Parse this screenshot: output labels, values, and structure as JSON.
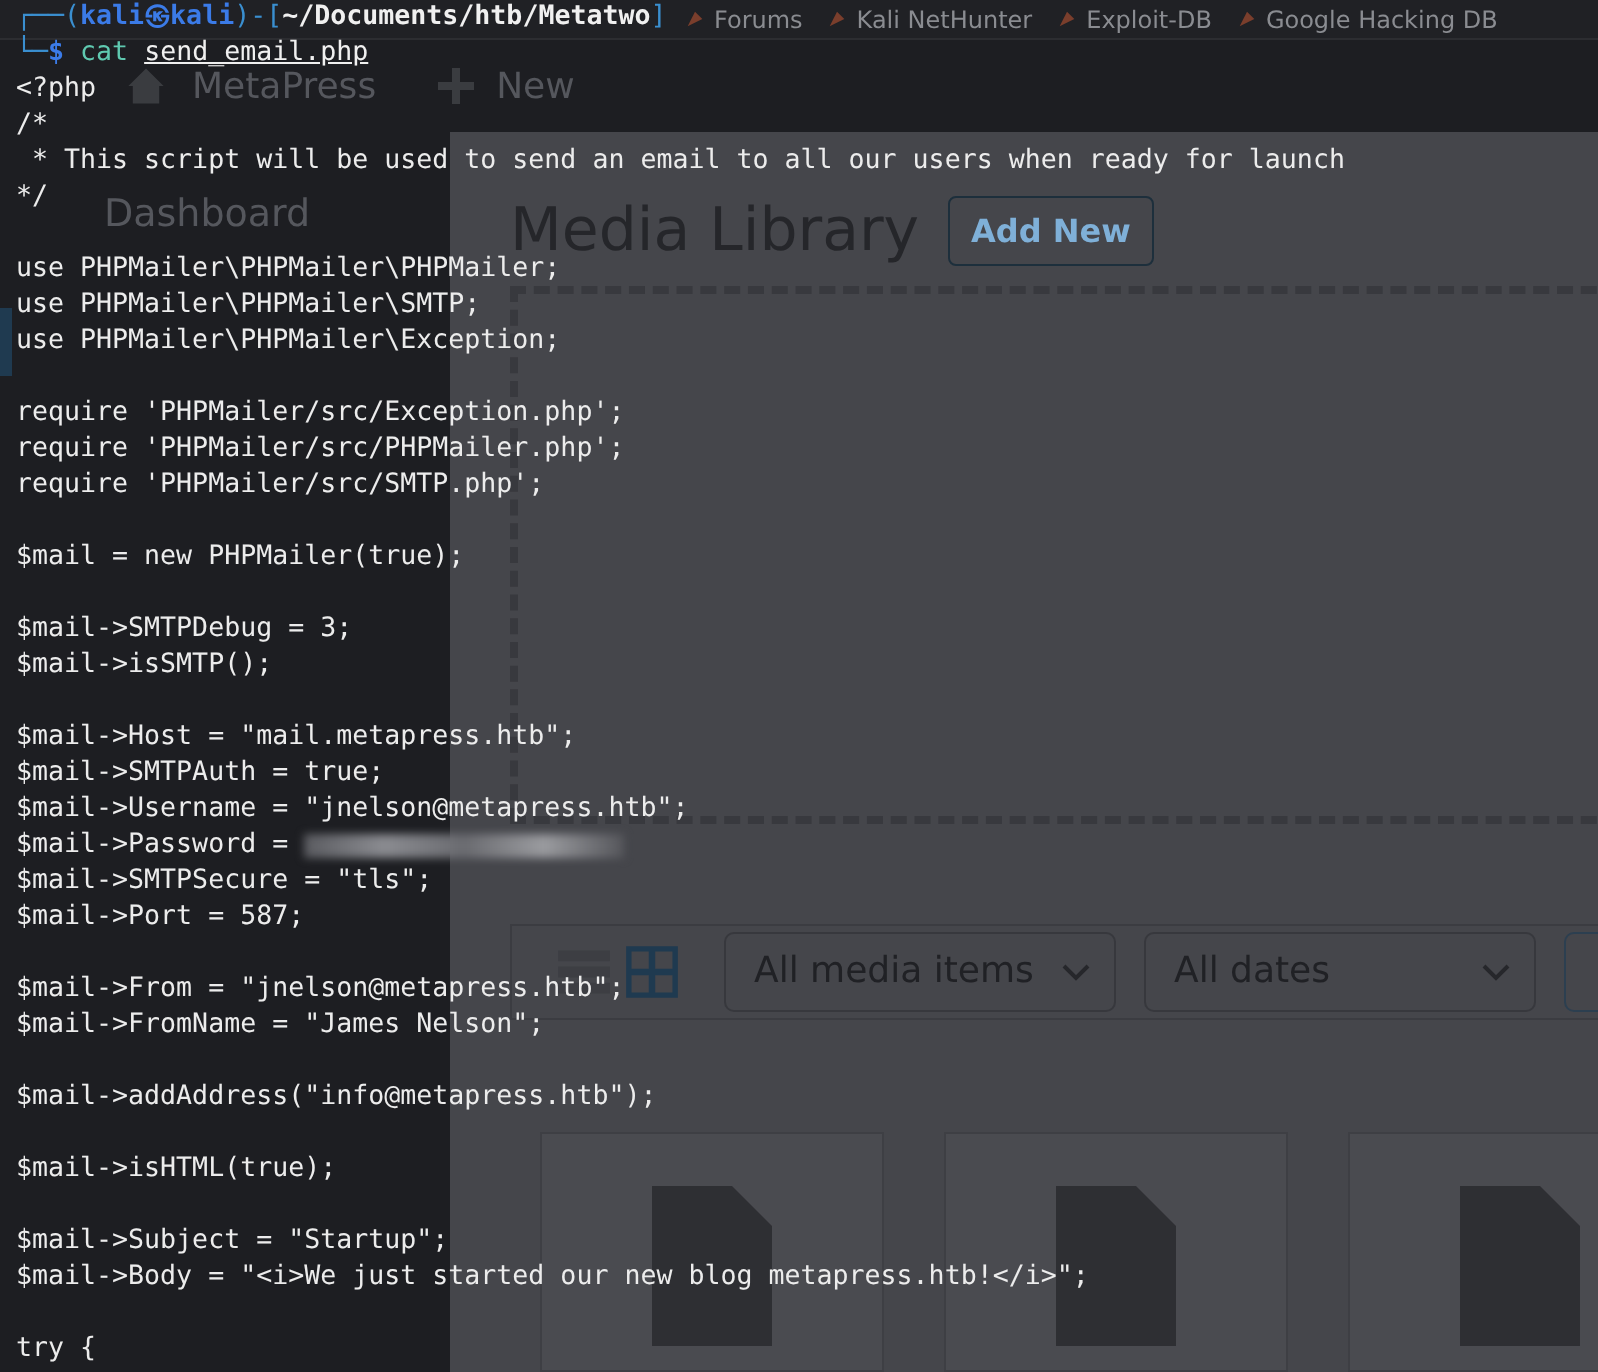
{
  "browser": {
    "bookmarks": [
      {
        "label": "Forums"
      },
      {
        "label": "Kali NetHunter"
      },
      {
        "label": "Exploit-DB"
      },
      {
        "label": "Google Hacking DB"
      }
    ]
  },
  "admin_bar": {
    "site": "MetaPress",
    "new": "New"
  },
  "sidebar": {
    "dashboard": "Dashboard"
  },
  "media_library": {
    "title": "Media Library",
    "add_button": "Add New",
    "filters": [
      "All media items",
      "All dates"
    ],
    "view_toggles": [
      {
        "selected": false
      },
      {
        "selected": true
      }
    ]
  },
  "terminal": {
    "prompt": [
      [
        {
          "text": "┌──(",
          "kind": "frame"
        },
        {
          "text": "kali㉿kali",
          "kind": "user"
        },
        {
          "text": ")-[",
          "kind": "frame"
        },
        {
          "text": "~/Documents/htb/Metatwo",
          "kind": "path"
        },
        {
          "text": "]",
          "kind": "frame"
        }
      ],
      [
        {
          "text": "└─",
          "kind": "frame"
        },
        {
          "text": "$",
          "kind": "sigil"
        },
        {
          "text": "cat",
          "kind": "command"
        },
        {
          "text": "send_email.php",
          "kind": "argument"
        }
      ]
    ],
    "lines": [
      {
        "kind": "code",
        "text": "<?php"
      },
      {
        "kind": "code",
        "text": "/*"
      },
      {
        "kind": "code",
        "text": " * This script will be used to send an email to all our users when ready for launch"
      },
      {
        "kind": "code",
        "text": "*/"
      },
      {
        "kind": "blank"
      },
      {
        "kind": "code",
        "text": "use PHPMailer\\PHPMailer\\PHPMailer;"
      },
      {
        "kind": "code",
        "text": "use PHPMailer\\PHPMailer\\SMTP;"
      },
      {
        "kind": "code",
        "text": "use PHPMailer\\PHPMailer\\Exception;"
      },
      {
        "kind": "blank"
      },
      {
        "kind": "code",
        "text": "require 'PHPMailer/src/Exception.php';"
      },
      {
        "kind": "code",
        "text": "require 'PHPMailer/src/PHPMailer.php';"
      },
      {
        "kind": "code",
        "text": "require 'PHPMailer/src/SMTP.php';"
      },
      {
        "kind": "blank"
      },
      {
        "kind": "code",
        "text": "$mail = new PHPMailer(true);"
      },
      {
        "kind": "blank"
      },
      {
        "kind": "code",
        "text": "$mail->SMTPDebug = 3;"
      },
      {
        "kind": "code",
        "text": "$mail->isSMTP();"
      },
      {
        "kind": "blank"
      },
      {
        "kind": "code",
        "text": "$mail->Host = \"mail.metapress.htb\";"
      },
      {
        "kind": "code",
        "text": "$mail->SMTPAuth = true;"
      },
      {
        "kind": "code",
        "text": "$mail->Username = \"jnelson@metapress.htb\";"
      },
      {
        "kind": "redacted",
        "text": "$mail->Password ="
      },
      {
        "kind": "code",
        "text": "$mail->SMTPSecure = \"tls\";"
      },
      {
        "kind": "code",
        "text": "$mail->Port = 587;"
      },
      {
        "kind": "blank"
      },
      {
        "kind": "code",
        "text": "$mail->From = \"jnelson@metapress.htb\";"
      },
      {
        "kind": "code",
        "text": "$mail->FromName = \"James Nelson\";"
      },
      {
        "kind": "blank"
      },
      {
        "kind": "code",
        "text": "$mail->addAddress(\"info@metapress.htb\");"
      },
      {
        "kind": "blank"
      },
      {
        "kind": "code",
        "text": "$mail->isHTML(true);"
      },
      {
        "kind": "blank"
      },
      {
        "kind": "code",
        "text": "$mail->Subject = \"Startup\";"
      },
      {
        "kind": "code",
        "text": "$mail->Body = \"<i>We just started our new blog metapress.htb!</i>\";"
      },
      {
        "kind": "blank"
      },
      {
        "kind": "code",
        "text": "try {"
      }
    ]
  }
}
